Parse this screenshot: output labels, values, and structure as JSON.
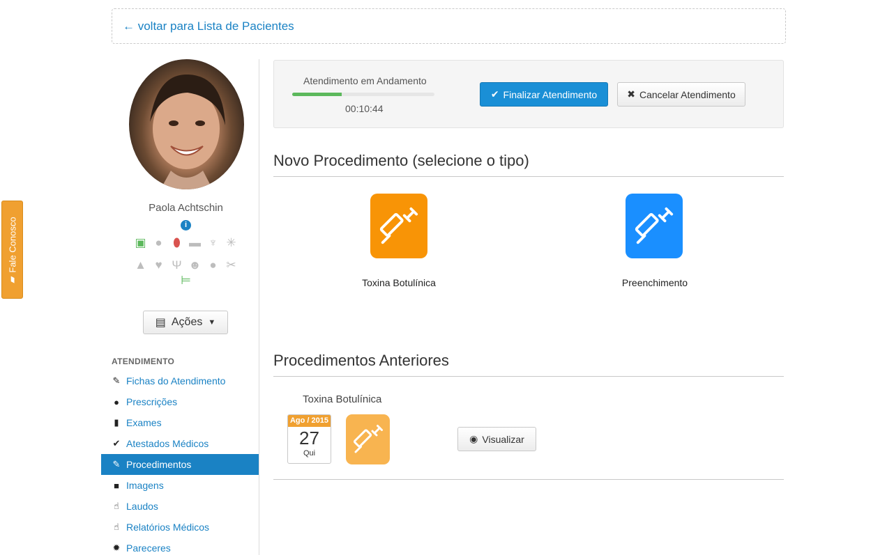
{
  "feedback": {
    "label": "Fale Conosco"
  },
  "back": {
    "label": "← voltar para Lista de Pacientes"
  },
  "patient": {
    "name": "Paola Achtschin",
    "info_icon": "i",
    "icons_row1": [
      "scale-icon",
      "bomb-icon",
      "pill-icon",
      "cigarette-icon",
      "wine-glass-icon",
      "cannabis-leaf-icon"
    ],
    "icons_row2": [
      "graduation-cap-icon",
      "heart-icon",
      "psi-icon",
      "smiley-icon",
      "apple-icon",
      "scissors-icon"
    ],
    "icons_row3": [
      "bed-icon"
    ]
  },
  "actions": {
    "label": "Ações",
    "icon": "list-icon"
  },
  "nav": {
    "header": "ATENDIMENTO",
    "items": [
      {
        "label": "Fichas do Atendimento",
        "icon": "pencil-icon",
        "glyph": "✎"
      },
      {
        "label": "Prescrições",
        "icon": "drop-icon",
        "glyph": "●"
      },
      {
        "label": "Exames",
        "icon": "signal-icon",
        "glyph": "▮"
      },
      {
        "label": "Atestados Médicos",
        "icon": "check-icon",
        "glyph": "✔"
      },
      {
        "label": "Procedimentos",
        "icon": "wrench-icon",
        "glyph": "✎",
        "active": true
      },
      {
        "label": "Imagens",
        "icon": "camera-icon",
        "glyph": "■"
      },
      {
        "label": "Laudos",
        "icon": "thumbs-up-icon",
        "glyph": "☝"
      },
      {
        "label": "Relatórios Médicos",
        "icon": "thumbs-up-icon",
        "glyph": "☝"
      },
      {
        "label": "Pareceres",
        "icon": "certificate-icon",
        "glyph": "✹"
      }
    ]
  },
  "session": {
    "status": "Atendimento em Andamento",
    "timer": "00:10:44",
    "progress_fraction": 0.35,
    "finalize_label": "Finalizar Atendimento",
    "cancel_label": "Cancelar Atendimento"
  },
  "new_procedure": {
    "title": "Novo Procedimento (selecione o tipo)",
    "types": [
      {
        "label": "Toxina Botulínica",
        "icon": "syringe-icon",
        "color": "#f89406"
      },
      {
        "label": "Preenchimento",
        "icon": "syringe-icon",
        "color": "#1a8fff"
      }
    ]
  },
  "previous": {
    "title": "Procedimentos Anteriores",
    "items": [
      {
        "name": "Toxina Botulínica",
        "month": "Ago / 2015",
        "day": "27",
        "weekday": "Qui",
        "icon": "syringe-icon",
        "color": "#f8b450",
        "view_label": "Visualizar"
      }
    ]
  }
}
